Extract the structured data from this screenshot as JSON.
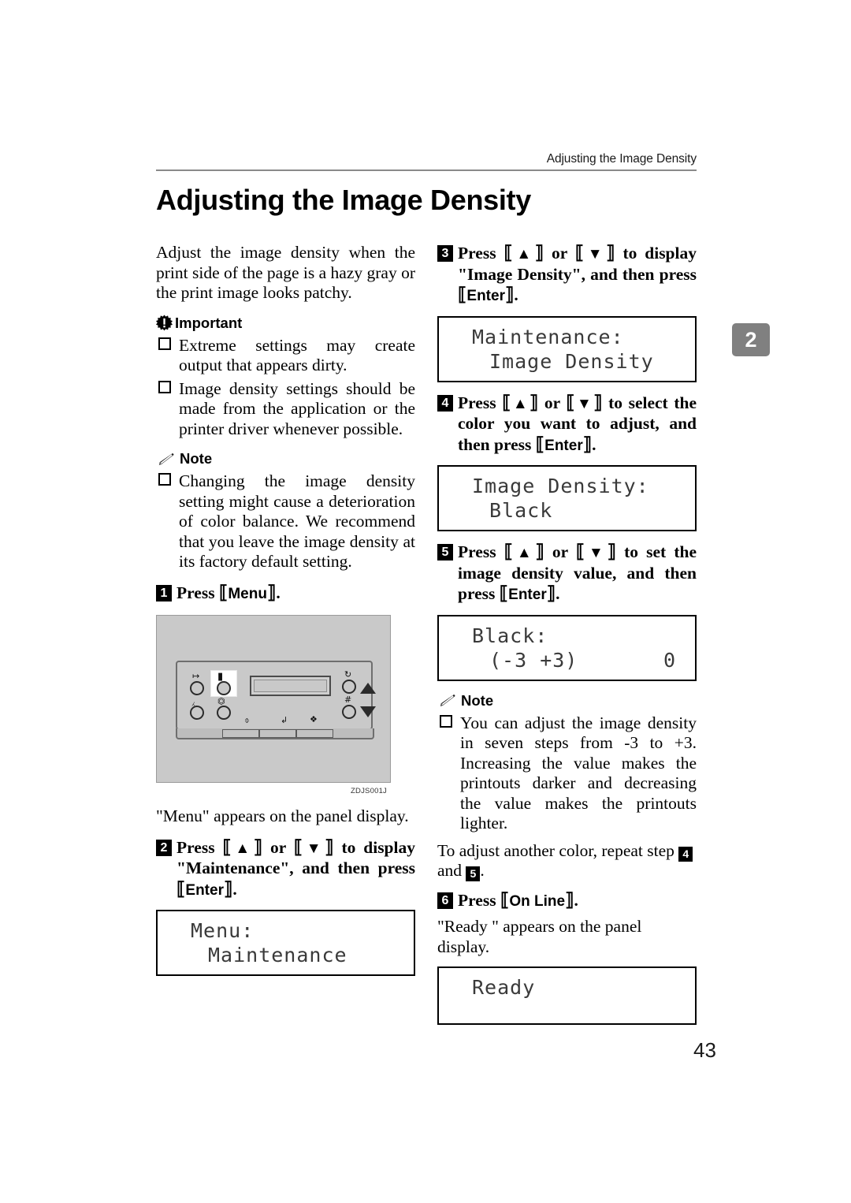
{
  "header": {
    "running_head": "Adjusting the Image Density",
    "page_title": "Adjusting the Image Density",
    "chapter_tab": "2"
  },
  "footer": {
    "page_number": "43"
  },
  "left_column": {
    "intro": "Adjust the image density when the print side of the page is a hazy gray or the print image looks patchy.",
    "important": {
      "label": "Important",
      "icon": "important-burst-icon",
      "items": [
        "Extreme settings may create output that appears dirty.",
        "Image density settings should be made from the application or the printer driver whenever possible."
      ]
    },
    "note": {
      "label": "Note",
      "icon": "pencil-icon",
      "items": [
        "Changing the image density setting might cause a deterioration of color balance. We recommend that you leave the image density at its factory default setting."
      ]
    },
    "step1": {
      "num": "1",
      "text_pre": "Press ",
      "key": "Menu",
      "text_post": "."
    },
    "figure": {
      "caption": "ZDJS001J",
      "name": "printer-control-panel",
      "button_symbols": [
        "form-feed-icon",
        "job-reset-icon",
        "on-line-icon",
        "menu-icon",
        "escape-icon",
        "enter-icon",
        "reset-icon",
        "hash-icon"
      ]
    },
    "after_figure": "\"Menu\" appears on the panel display.",
    "step2": {
      "num": "2",
      "seg1": "Press ",
      "key_up": "▲",
      "seg2": " or ",
      "key_down": "▼",
      "seg3": " to display \"Maintenance\", and then press ",
      "key_enter": "Enter",
      "seg4": "."
    },
    "lcd_menu": {
      "line1": "Menu:",
      "line2": "Maintenance"
    }
  },
  "right_column": {
    "step3": {
      "num": "3",
      "seg1": "Press ",
      "key_up": "▲",
      "seg2": " or ",
      "key_down": "▼",
      "seg3": " to display \"Image Density\", and then press ",
      "key_enter": "Enter",
      "seg4": "."
    },
    "lcd_maintenance": {
      "line1": "Maintenance:",
      "line2": "Image Density"
    },
    "step4": {
      "num": "4",
      "seg1": "Press ",
      "key_up": "▲",
      "seg2": " or ",
      "key_down": "▼",
      "seg3": " to select the color you want to adjust, and then press ",
      "key_enter": "Enter",
      "seg4": "."
    },
    "lcd_image_density": {
      "line1": "Image Density:",
      "line2": "Black"
    },
    "step5": {
      "num": "5",
      "seg1": "Press ",
      "key_up": "▲",
      "seg2": " or ",
      "key_down": "▼",
      "seg3": " to set the image density value, and then press ",
      "key_enter": "Enter",
      "seg4": "."
    },
    "lcd_black": {
      "line1": "Black:",
      "line2": "(-3 +3)",
      "value": "0"
    },
    "note": {
      "label": "Note",
      "icon": "pencil-icon",
      "items": [
        "You can adjust the image density in seven steps from -3 to +3. Increasing the value makes the printouts darker and decreasing the value makes the printouts lighter."
      ],
      "repeat_pre": "To adjust another color, repeat step ",
      "repeat_num1": "4",
      "repeat_mid": " and ",
      "repeat_num2": "5",
      "repeat_post": "."
    },
    "step6": {
      "num": "6",
      "text_pre": "Press ",
      "key": "On Line",
      "text_post": "."
    },
    "after_step6": "\"Ready \" appears on the panel display.",
    "lcd_ready": {
      "line1": "Ready",
      "line2": ""
    }
  }
}
